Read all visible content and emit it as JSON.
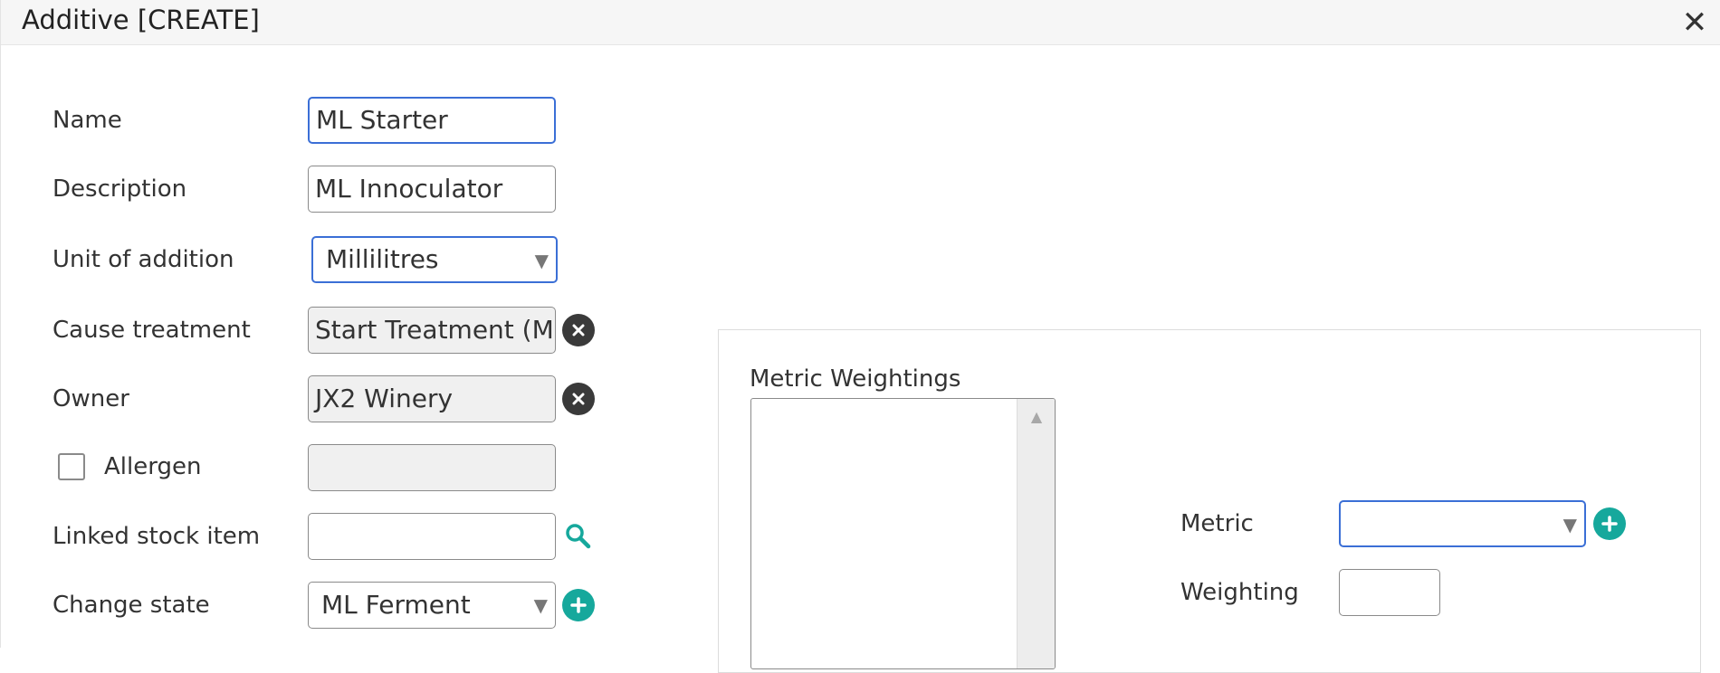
{
  "dialog": {
    "title": "Additive [CREATE]",
    "close_symbol": "✕"
  },
  "form": {
    "name": {
      "label": "Name",
      "value": "ML Starter"
    },
    "description": {
      "label": "Description",
      "value": "ML Innoculator"
    },
    "unit_of_addition": {
      "label": "Unit of addition",
      "value": "Millilitres"
    },
    "cause_treatment": {
      "label": "Cause treatment",
      "value": "Start Treatment (M"
    },
    "owner": {
      "label": "Owner",
      "value": "JX2 Winery"
    },
    "allergen": {
      "label": "Allergen",
      "checked": false,
      "value": ""
    },
    "linked_stock_item": {
      "label": "Linked stock item",
      "value": ""
    },
    "change_state": {
      "label": "Change state",
      "value": "ML Ferment"
    }
  },
  "metric_weightings": {
    "title": "Metric Weightings",
    "items": [],
    "metric": {
      "label": "Metric",
      "value": ""
    },
    "weighting": {
      "label": "Weighting",
      "value": ""
    }
  },
  "icons": {
    "clear": "clear-icon",
    "search": "search-icon",
    "add": "plus-circle-icon",
    "dropdown": "caret-down-icon"
  },
  "colors": {
    "focus_border": "#3b6fd6",
    "accent_teal": "#16a89c",
    "clear_button": "#3a3a3a",
    "titlebar_bg": "#f6f6f6"
  }
}
